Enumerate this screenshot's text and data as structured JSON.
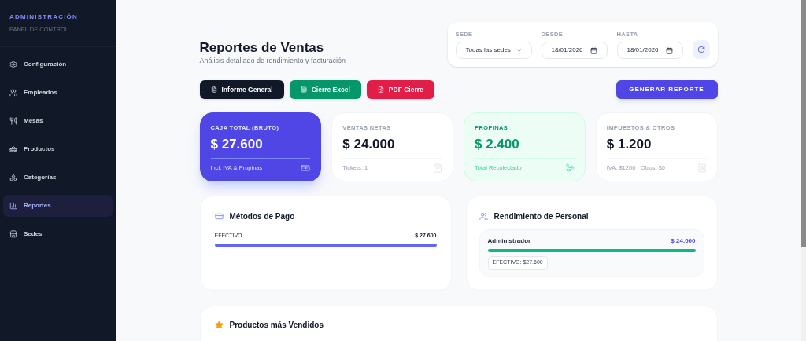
{
  "sidebar": {
    "title": "ADMINISTRACIÓN",
    "subtitle": "PANEL DE CONTROL",
    "items": [
      {
        "label": "Configuración",
        "selected": false
      },
      {
        "label": "Empleados",
        "selected": false
      },
      {
        "label": "Mesas",
        "selected": false
      },
      {
        "label": "Productos",
        "selected": false
      },
      {
        "label": "Categorías",
        "selected": false
      },
      {
        "label": "Reportes",
        "selected": true
      },
      {
        "label": "Sedes",
        "selected": false
      }
    ]
  },
  "header": {
    "title": "Reportes de Ventas",
    "subtitle": "Análisis detallado de rendimiento y facturación"
  },
  "filters": {
    "sede": {
      "label": "SEDE",
      "value": "Todas las sedes"
    },
    "desde": {
      "label": "DESDE",
      "value": "18/01/2026"
    },
    "hasta": {
      "label": "HASTA",
      "value": "18/01/2026"
    }
  },
  "export_buttons": [
    {
      "label": "Informe General",
      "kind": "dark"
    },
    {
      "label": "Cierre Excel",
      "kind": "green"
    },
    {
      "label": "PDF Cierre",
      "kind": "red"
    }
  ],
  "generate_button": "GENERAR REPORTE",
  "stats": [
    {
      "kind": "primary",
      "label": "CAJA TOTAL (BRUTO)",
      "value": "$ 27.600",
      "note": "Incl. IVA & Propinas"
    },
    {
      "kind": "plain",
      "label": "VENTAS NETAS",
      "value": "$ 24.000",
      "note": "Tickets: 1"
    },
    {
      "kind": "success",
      "label": "PROPINAS",
      "value": "$ 2.400",
      "note": "Total Recolectado"
    },
    {
      "kind": "plain",
      "label": "IMPUESTOS & OTROS",
      "value": "$ 1.200",
      "note": "IVA: $1200 · Otros: $0"
    }
  ],
  "payment_methods": {
    "title": "Métodos de Pago",
    "items": [
      {
        "name": "EFECTIVO",
        "amount": "$ 27.600",
        "level": 1
      }
    ]
  },
  "staff": {
    "title": "Rendimiento de Personal",
    "items": [
      {
        "name": "Administrador",
        "amount": "$ 24.000",
        "level": 1,
        "tags": [
          "EFECTIVO: $27.600"
        ]
      }
    ]
  },
  "top_products": {
    "title": "Productos más Vendidos"
  }
}
